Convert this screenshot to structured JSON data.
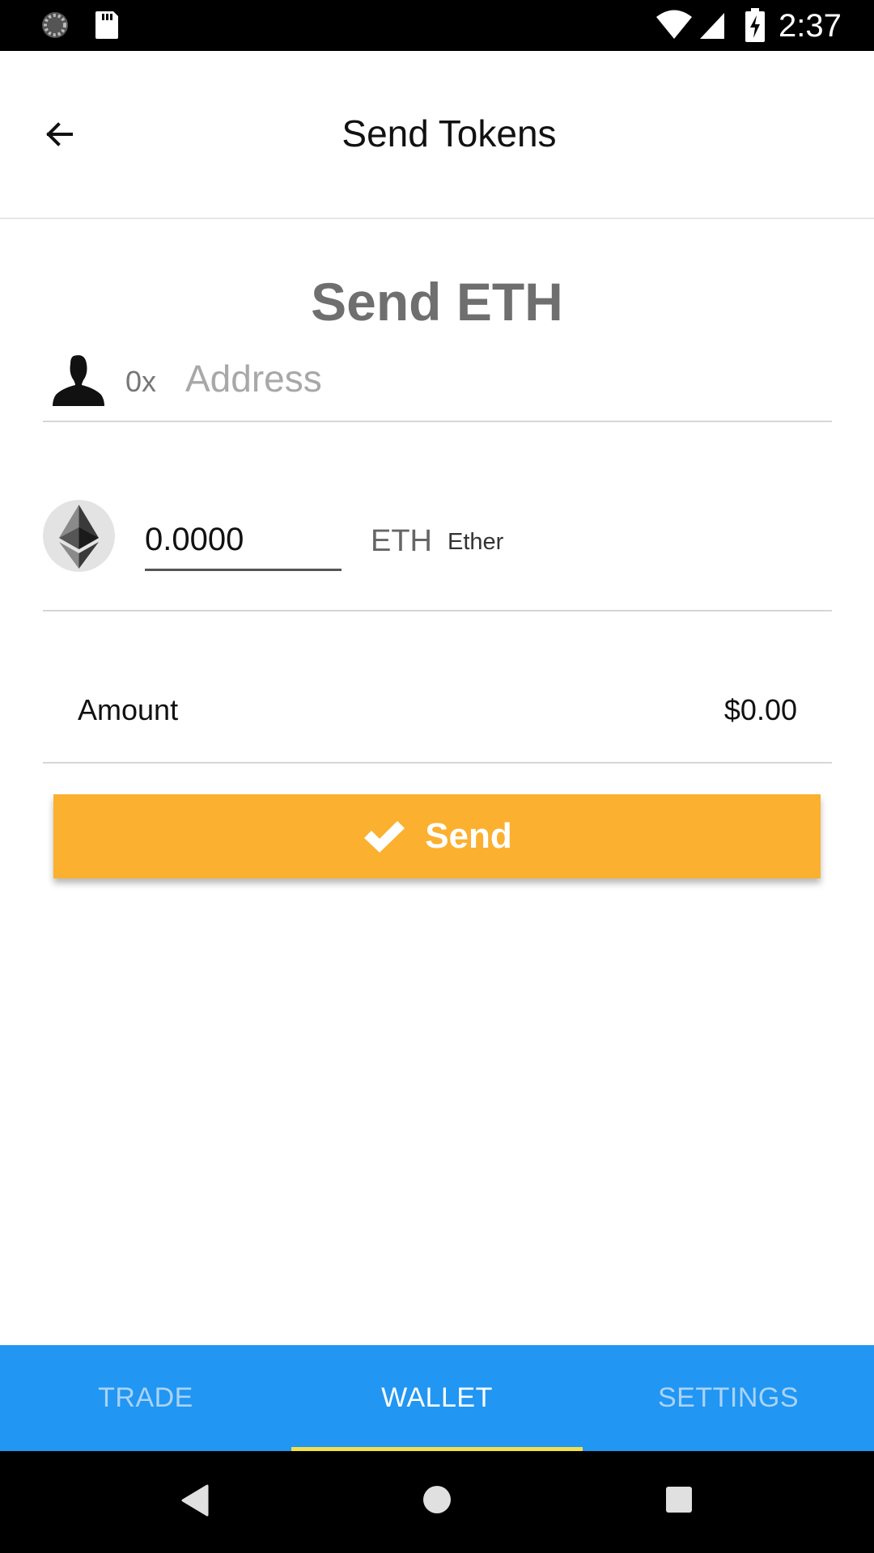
{
  "status_bar": {
    "time": "2:37",
    "icons": [
      "loading-spinner-icon",
      "sd-card-icon",
      "wifi-icon",
      "cell-signal-icon",
      "battery-charging-icon"
    ]
  },
  "app_bar": {
    "title": "Send Tokens",
    "back_icon": "arrow-back-icon"
  },
  "send_form": {
    "heading": "Send ETH",
    "address": {
      "icon": "person-icon",
      "prefix": "0x",
      "placeholder": "Address",
      "value": ""
    },
    "amount": {
      "token_icon": "ethereum-logo-icon",
      "value": "0.0000",
      "unit_symbol": "ETH",
      "unit_name": "Ether"
    },
    "fiat": {
      "label": "Amount",
      "value": "$0.00"
    },
    "send_button": {
      "icon": "checkmark-icon",
      "label": "Send",
      "color": "#FBB02F"
    }
  },
  "tabs": [
    {
      "label": "TRADE",
      "active": false
    },
    {
      "label": "WALLET",
      "active": true
    },
    {
      "label": "SETTINGS",
      "active": false
    }
  ],
  "colors": {
    "tab_bar": "#2196F3",
    "tab_indicator": "#F2E04A",
    "heading": "#6f6f6f"
  },
  "nav_bar": {
    "icons": [
      "nav-back-icon",
      "nav-home-icon",
      "nav-recents-icon"
    ]
  }
}
